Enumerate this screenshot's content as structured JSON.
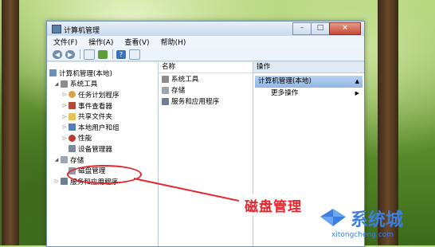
{
  "window": {
    "title": "计算机管理",
    "minimize_label": "–",
    "maximize_label": "□",
    "close_label": "×"
  },
  "menu": [
    "文件(F)",
    "操作(A)",
    "查看(V)",
    "帮助(H)"
  ],
  "toolbar": {
    "back_icon": "back-arrow-icon",
    "forward_icon": "forward-arrow-icon",
    "show_hide_tree_icon": "console-tree-icon",
    "export_icon": "export-list-icon",
    "help_icon": "help-icon",
    "properties_icon": "properties-icon",
    "back_label": "◀",
    "forward_label": "▶",
    "help_label": "?"
  },
  "tree": {
    "root": "计算机管理(本地)",
    "system_tools": "系统工具",
    "task_scheduler": "任务计划程序",
    "event_viewer": "事件查看器",
    "shared_folders": "共享文件夹",
    "local_users": "本地用户和组",
    "performance": "性能",
    "device_manager": "设备管理器",
    "storage": "存储",
    "disk_management": "磁盘管理",
    "services_apps": "服务和应用程序"
  },
  "list": {
    "header": "名称",
    "items": [
      "系统工具",
      "存储",
      "服务和应用程序"
    ]
  },
  "actions": {
    "header": "操作",
    "selected": "计算机管理(本地)",
    "more": "更多操作"
  },
  "annotation": {
    "label": "磁盘管理",
    "color": "#e8242c"
  },
  "watermark": {
    "text": "系统城",
    "url": "xitongcheng.com",
    "color": "#3d7fe0"
  }
}
